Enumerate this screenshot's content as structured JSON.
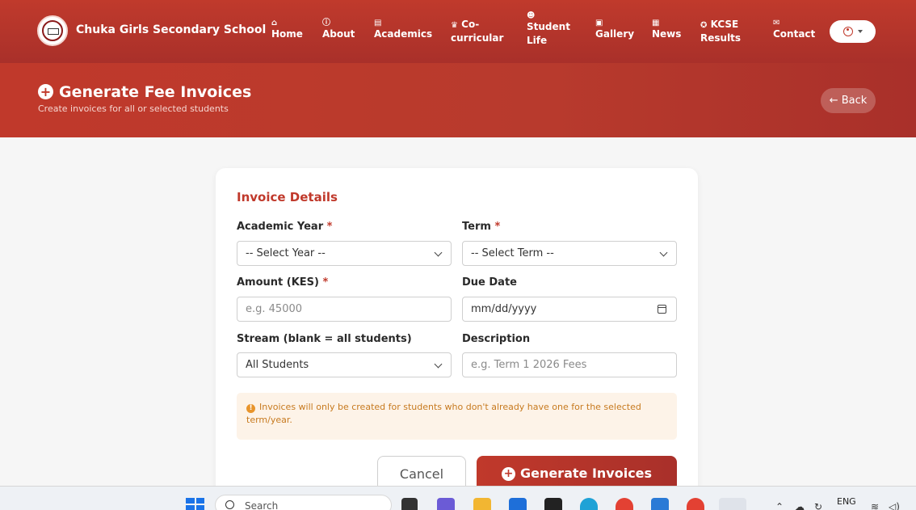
{
  "nav": {
    "brand": "Chuka Girls Secondary School",
    "items": [
      {
        "label": "Home",
        "icon": "house-icon",
        "glyph": "⌂"
      },
      {
        "label": "About",
        "icon": "info-circle-icon",
        "glyph": "ⓘ"
      },
      {
        "label": "Academics",
        "icon": "book-icon",
        "glyph": "▤"
      },
      {
        "label": "Co-curricular",
        "icon": "trophy-icon",
        "glyph": "♛"
      },
      {
        "label": "Student Life",
        "icon": "people-icon",
        "glyph": "☻"
      },
      {
        "label": "Gallery",
        "icon": "image-icon",
        "glyph": "▣"
      },
      {
        "label": "News",
        "icon": "newspaper-icon",
        "glyph": "▦"
      },
      {
        "label": "KCSE Results",
        "icon": "award-icon",
        "glyph": "✪"
      },
      {
        "label": "Contact",
        "icon": "chat-icon",
        "glyph": "✉"
      }
    ]
  },
  "header": {
    "title": "Generate Fee Invoices",
    "subtitle": "Create invoices for all or selected students",
    "back_label": "← Back"
  },
  "form": {
    "section_title": "Invoice Details",
    "academic_year": {
      "label": "Academic Year",
      "value": "-- Select Year --"
    },
    "term": {
      "label": "Term",
      "value": "-- Select Term --"
    },
    "amount": {
      "label": "Amount (KES)",
      "placeholder": "e.g. 45000"
    },
    "due_date": {
      "label": "Due Date",
      "placeholder": "mm/dd/yyyy"
    },
    "stream": {
      "label": "Stream (blank = all students)",
      "value": "All Students"
    },
    "description": {
      "label": "Description",
      "placeholder": "e.g. Term 1 2026 Fees"
    },
    "required_mark": "*",
    "note": "Invoices will only be created for students who don't already have one for the selected term/year.",
    "cancel_label": "Cancel",
    "generate_label": "Generate Invoices"
  },
  "taskbar": {
    "search_placeholder": "Search",
    "lang": "ENG"
  },
  "colors": {
    "primary": "#c0392b",
    "primary_dark": "#a9302a",
    "note_bg": "#fdf3e8",
    "note_text": "#c77a1f"
  }
}
